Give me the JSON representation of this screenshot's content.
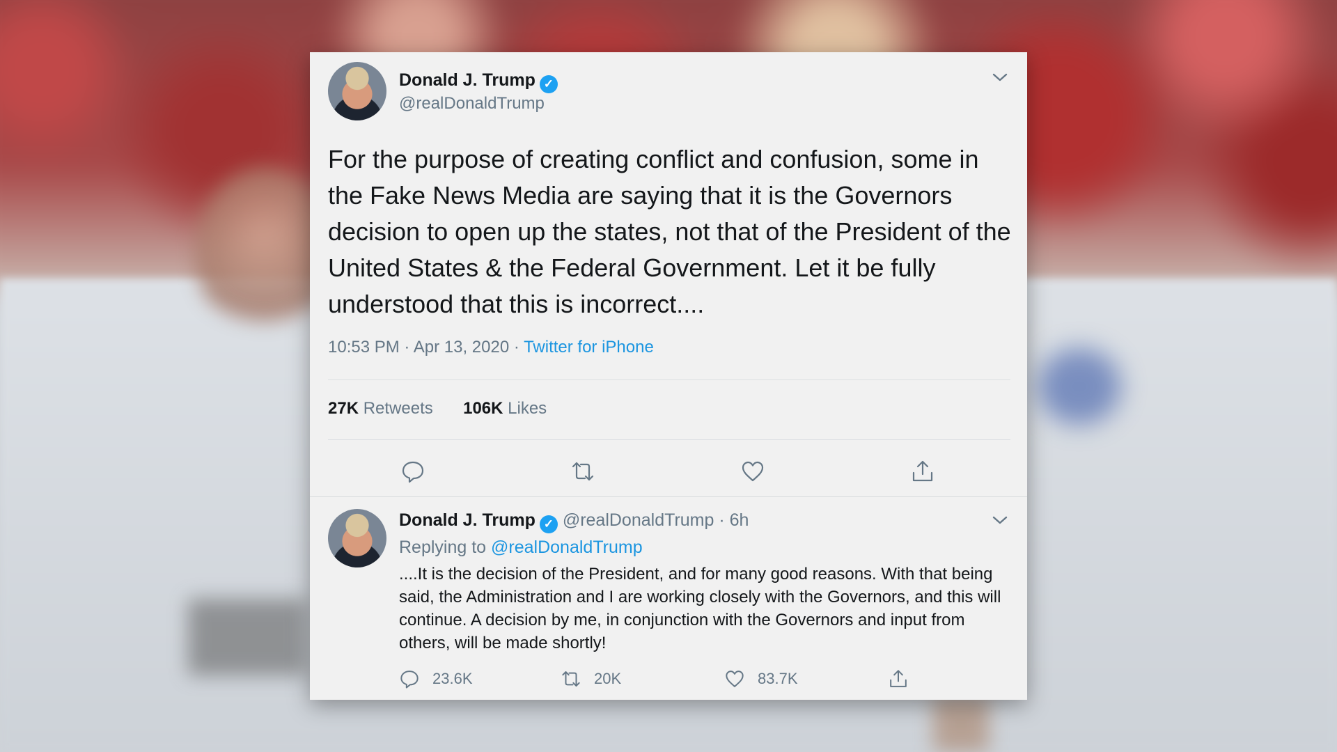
{
  "tweet": {
    "author_name": "Donald J. Trump",
    "author_handle": "@realDonaldTrump",
    "verified_mark": "✓",
    "text": "For the purpose of creating conflict and confusion, some in the Fake News Media are saying that it is the Governors decision to open up the states, not that of the President of the United States & the Federal Government. Let it be fully understood that this is incorrect....",
    "time": "10:53 PM · Apr 13, 2020 ·",
    "source": "Twitter for iPhone",
    "retweets_count": "27K",
    "retweets_label": "Retweets",
    "likes_count": "106K",
    "likes_label": "Likes"
  },
  "reply": {
    "author_name": "Donald J. Trump",
    "author_handle": "@realDonaldTrump",
    "age": "· 6h",
    "replying_prefix": "Replying to",
    "replying_to": "@realDonaldTrump",
    "text": "....It is the decision of the President, and for many good reasons. With that being said, the Administration and I are working closely with the Governors, and this will continue. A decision by me, in conjunction with the Governors and input from others, will be made shortly!",
    "replies_count": "23.6K",
    "retweets_count": "20K",
    "likes_count": "83.7K"
  },
  "icons": {
    "verified": "verified-badge-icon",
    "menu": "chevron-down-icon",
    "reply": "reply-bubble-icon",
    "retweet": "retweet-icon",
    "like": "heart-icon",
    "share": "share-icon"
  },
  "colors": {
    "link": "#1b95e0",
    "verified": "#1da1f2",
    "muted": "#657786",
    "card_bg": "#f1f1f1"
  }
}
